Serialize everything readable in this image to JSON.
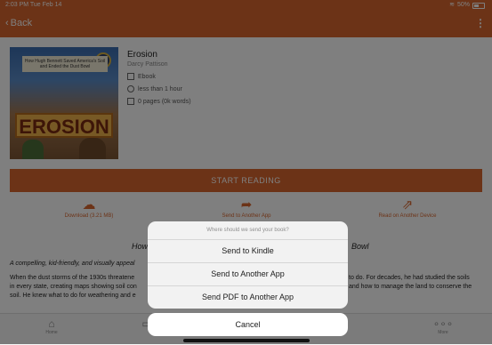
{
  "status_bar": {
    "time": "2:03 PM  Tue Feb 14",
    "battery": "50%"
  },
  "navbar": {
    "back_label": "Back",
    "menu_glyph": "⋮"
  },
  "book": {
    "cover_logo_text": "EROSION",
    "cover_banner_text": "How Hugh Bennett Saved America's Soil and Ended the Dust Bowl",
    "title": "Erosion",
    "author": "Darcy Pattison",
    "format": "Ebook",
    "duration": "less than 1 hour",
    "pages": "0 pages (0k words)"
  },
  "start_reading_label": "START READING",
  "actions": [
    {
      "icon": "cloud-download-icon",
      "glyph": "☁",
      "label": "Download (3.21 MB)"
    },
    {
      "icon": "share-arrow-icon",
      "glyph": "➦",
      "label": "Send to Another App"
    },
    {
      "icon": "external-open-icon",
      "glyph": "⇗",
      "label": "Read on Another Device"
    }
  ],
  "description": {
    "subtitle_left": "How",
    "subtitle_right": "Bowl",
    "lead": "A compelling, kid-friendly, and visually appeal",
    "para_left": "When the dust storms of the 1930s threatene",
    "para_left2": "in every state, creating maps showing soil con",
    "para_left3": "soil. He knew what to do for weathering and e",
    "para_right": "to do. For decades, he had studied the soils",
    "para_right2": "and how to manage the land to conserve the"
  },
  "tabs": [
    {
      "icon": "home-icon",
      "glyph": "⌂",
      "label": "Home"
    },
    {
      "icon": "library-icon",
      "glyph": "▭",
      "label": ""
    },
    {
      "icon": "search-icon",
      "glyph": "⌕",
      "label": ""
    },
    {
      "icon": "more-icon",
      "glyph": "∘∘∘",
      "label": "More"
    }
  ],
  "sheet": {
    "prompt": "Where should we send your book?",
    "options": [
      "Send to Kindle",
      "Send to Another App",
      "Send PDF to Another App"
    ],
    "cancel": "Cancel"
  },
  "colors": {
    "accent": "#d9672f",
    "overlay": "rgba(0,0,0,0.5)"
  }
}
